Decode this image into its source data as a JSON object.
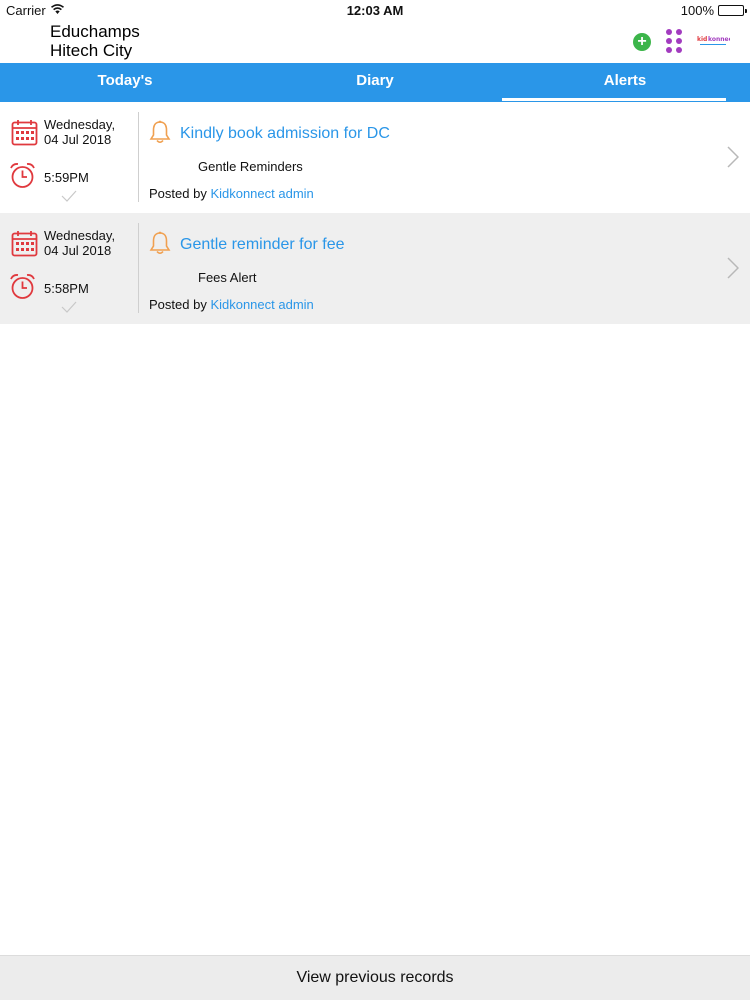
{
  "status_bar": {
    "carrier": "Carrier",
    "time": "12:03 AM",
    "battery": "100%"
  },
  "header": {
    "title_line1": "Educhamps",
    "title_line2": "Hitech City",
    "add_icon": "plus-circle-icon",
    "menu_icon": "grid-dots-icon",
    "logo": "kidkonnect-logo"
  },
  "tabs": [
    {
      "label": "Today's",
      "active": false
    },
    {
      "label": "Diary",
      "active": false
    },
    {
      "label": "Alerts",
      "active": true
    }
  ],
  "alerts": [
    {
      "day": "Wednesday,",
      "date": "04 Jul 2018",
      "time": "5:59PM",
      "title": "Kindly book admission for DC",
      "category": "Gentle Reminders",
      "posted_prefix": "Posted by ",
      "author": "Kidkonnect admin"
    },
    {
      "day": "Wednesday,",
      "date": "04 Jul 2018",
      "time": "5:58PM",
      "title": "Gentle reminder for fee",
      "category": "Fees Alert",
      "posted_prefix": "Posted by ",
      "author": "Kidkonnect admin"
    }
  ],
  "footer": {
    "label": "View previous records"
  },
  "colors": {
    "accent": "#2a96e8",
    "icon_red": "#e0393e",
    "bell_orange": "#f0a050",
    "add_green": "#3cb54a",
    "menu_purple": "#a23bbf"
  }
}
